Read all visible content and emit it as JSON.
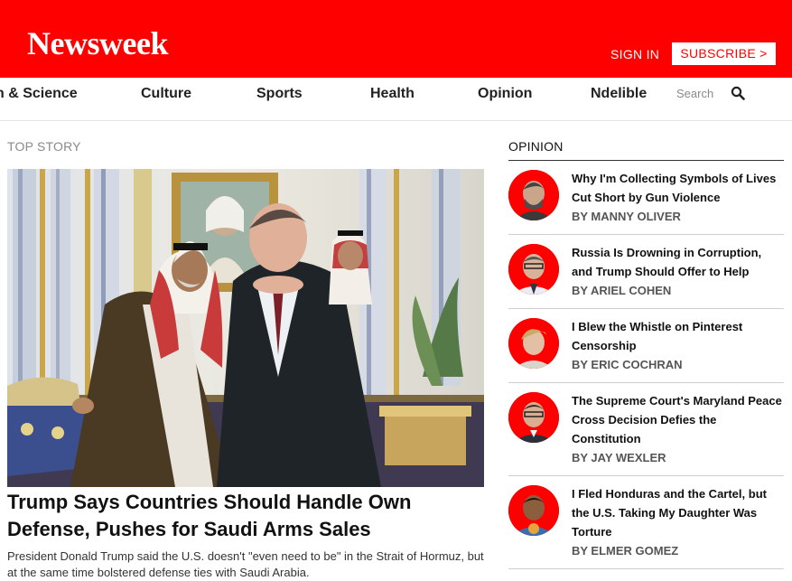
{
  "header": {
    "logo": "Newsweek",
    "sign_in": "SIGN IN",
    "subscribe": "SUBSCRIBE >",
    "brand_color": "#ff0000"
  },
  "nav": {
    "items": [
      "n & Science",
      "Culture",
      "Sports",
      "Health",
      "Opinion",
      "Ndelible"
    ],
    "search_label": "Search",
    "search_icon": "search-icon"
  },
  "top_story": {
    "section_label": "TOP STORY",
    "headline": "Trump Says Countries Should Handle Own Defense, Pushes for Saudi Arms Sales",
    "summary": "President Donald Trump said the U.S. doesn't \"even need to be\" in the Strait of Hormuz, but at the same time bolstered defense ties with Saudi Arabia."
  },
  "opinion": {
    "title": "OPINION",
    "items": [
      {
        "headline": "Why I'm Collecting Symbols of Lives Cut Short by Gun Violence",
        "byline": "BY MANNY OLIVER"
      },
      {
        "headline": "Russia Is Drowning in Corruption, and Trump Should Offer to Help",
        "byline": "BY ARIEL COHEN"
      },
      {
        "headline": "I Blew the Whistle on Pinterest Censorship",
        "byline": "BY ERIC COCHRAN"
      },
      {
        "headline": "The Supreme Court's Maryland Peace Cross Decision Defies the Constitution",
        "byline": "BY JAY WEXLER"
      },
      {
        "headline": "I Fled Honduras and the Cartel, but the U.S. Taking My Daughter Was Torture",
        "byline": "BY ELMER GOMEZ"
      }
    ]
  }
}
